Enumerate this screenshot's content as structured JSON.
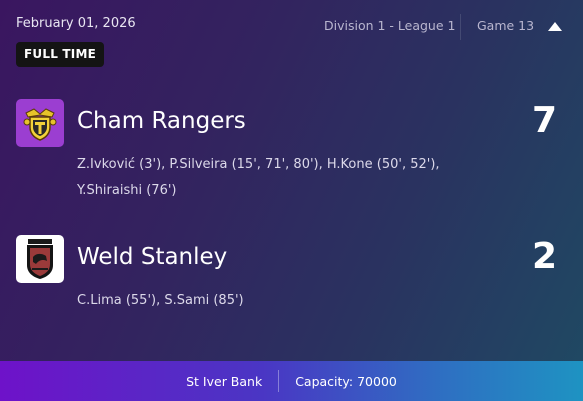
{
  "match": {
    "date": "February 01, 2026",
    "league": "Division 1 - League 1",
    "game": "Game 13",
    "status_badge": "FULL TIME"
  },
  "home": {
    "name": "Cham Rangers",
    "score": "7",
    "scorers": "Z.Ivković (3'), P.Silveira (15', 71', 80'), H.Kone (50', 52'), Y.Shiraishi (76')",
    "crest_color": "#9b3ed1"
  },
  "away": {
    "name": "Weld Stanley",
    "score": "2",
    "scorers": "C.Lima (55'), S.Sami (85')",
    "crest_color": "#ffffff"
  },
  "venue": {
    "stadium": "St Iver Bank",
    "capacity": "Capacity: 70000"
  },
  "icons": {
    "collapse": "chevron-up-icon"
  }
}
